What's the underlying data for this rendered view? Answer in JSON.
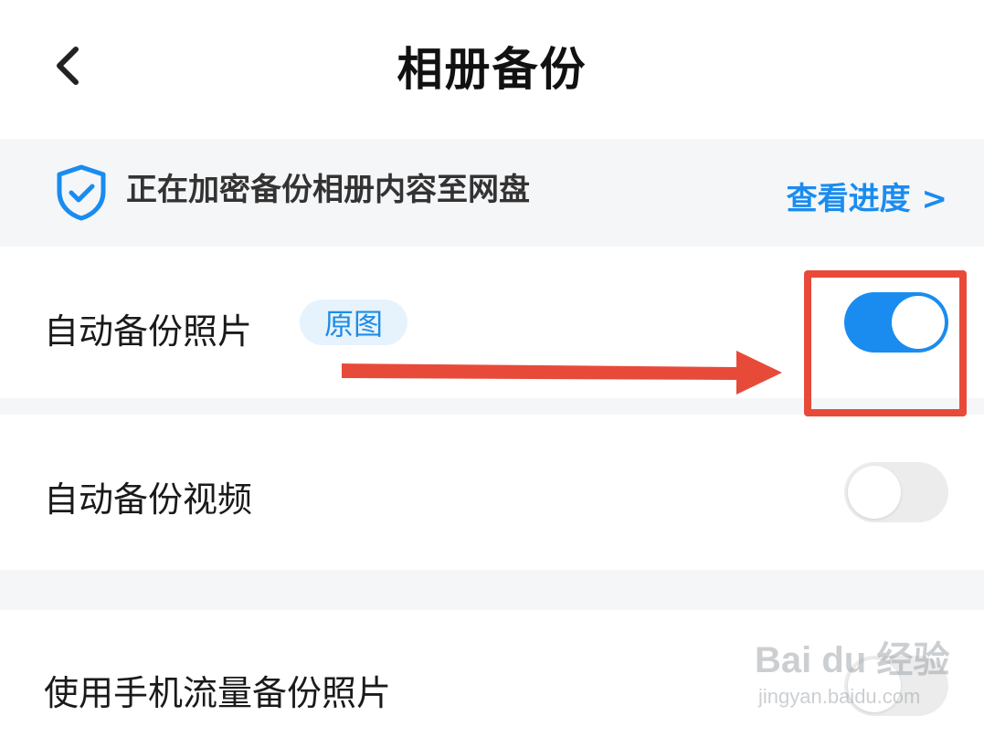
{
  "header": {
    "title": "相册备份",
    "back_icon": "chevron-left-icon"
  },
  "banner": {
    "icon": "shield-check-icon",
    "text": "正在加密备份相册内容至网盘",
    "link": "查看进度 >",
    "accent_color": "#1a8cef"
  },
  "settings": [
    {
      "label": "自动备份照片",
      "badge": "原图",
      "toggle_on": true
    },
    {
      "label": "自动备份视频",
      "toggle_on": false
    },
    {
      "label": "使用手机流量备份照片",
      "toggle_on": false
    }
  ],
  "annotation": {
    "color": "#e84a3a"
  },
  "watermark": {
    "brand": "Bai du 经验",
    "url": "jingyan.baidu.com"
  }
}
